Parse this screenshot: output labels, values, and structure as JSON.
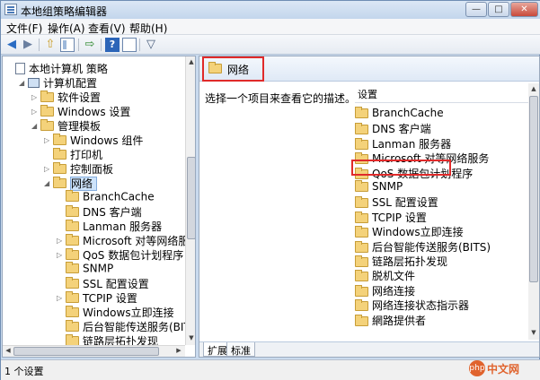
{
  "window": {
    "title": "本地组策略编辑器",
    "controls": {
      "minimize": "—",
      "maximize": "□",
      "close": "✕"
    }
  },
  "menubar": {
    "items": [
      "文件(F)",
      "操作(A)",
      "查看(V)",
      "帮助(H)"
    ]
  },
  "toolbar": {
    "icons": [
      "back-arrow-icon",
      "forward-arrow-icon",
      "up-folder-icon",
      "show-hide-tree-icon",
      "export-list-icon",
      "help-icon",
      "properties-icon",
      "filter-icon"
    ]
  },
  "tree": {
    "items": [
      {
        "label": "本地计算机 策略",
        "icon": "policy-icon",
        "expander": ""
      },
      {
        "label": "计算机配置",
        "icon": "computer-icon",
        "expander": "◢"
      },
      {
        "label": "软件设置",
        "icon": "folder-icon",
        "expander": "▷"
      },
      {
        "label": "Windows 设置",
        "icon": "folder-icon",
        "expander": "▷"
      },
      {
        "label": "管理模板",
        "icon": "folder-icon",
        "expander": "◢"
      },
      {
        "label": "Windows 组件",
        "icon": "folder-icon",
        "expander": "▷"
      },
      {
        "label": "打印机",
        "icon": "folder-icon",
        "expander": ""
      },
      {
        "label": "控制面板",
        "icon": "folder-icon",
        "expander": "▷"
      },
      {
        "label": "网络",
        "icon": "folder-icon",
        "expander": "◢"
      },
      {
        "label": "BranchCache",
        "icon": "folder-icon",
        "expander": ""
      },
      {
        "label": "DNS 客户端",
        "icon": "folder-icon",
        "expander": ""
      },
      {
        "label": "Lanman 服务器",
        "icon": "folder-icon",
        "expander": ""
      },
      {
        "label": "Microsoft 对等网络服务",
        "icon": "folder-icon",
        "expander": "▷"
      },
      {
        "label": "QoS 数据包计划程序",
        "icon": "folder-icon",
        "expander": "▷"
      },
      {
        "label": "SNMP",
        "icon": "folder-icon",
        "expander": ""
      },
      {
        "label": "SSL 配置设置",
        "icon": "folder-icon",
        "expander": ""
      },
      {
        "label": "TCPIP 设置",
        "icon": "folder-icon",
        "expander": "▷"
      },
      {
        "label": "Windows立即连接",
        "icon": "folder-icon",
        "expander": ""
      },
      {
        "label": "后台智能传送服务(BITS)",
        "icon": "folder-icon",
        "expander": ""
      },
      {
        "label": "链路层拓扑发现",
        "icon": "folder-icon",
        "expander": ""
      },
      {
        "label": "脱机文件",
        "icon": "folder-icon",
        "expander": ""
      }
    ]
  },
  "right": {
    "header_title": "网络",
    "description": "选择一个项目来查看它的描述。",
    "settings_header": "设置",
    "settings": [
      "BranchCache",
      "DNS 客户端",
      "Lanman 服务器",
      "Microsoft 对等网络服务",
      "QoS 数据包计划程序",
      "SNMP",
      "SSL 配置设置",
      "TCPIP 设置",
      "Windows立即连接",
      "后台智能传送服务(BITS)",
      "链路层拓扑发现",
      "脱机文件",
      "网络连接",
      "网络连接状态指示器",
      "網路提供者"
    ]
  },
  "tabs": [
    "扩展",
    "标准"
  ],
  "status": {
    "text": "1 个设置"
  },
  "watermark": {
    "logo": "php",
    "text": "中文网"
  },
  "colors": {
    "highlight_border": "#e02a2a",
    "selection_bg": "#cde3fb",
    "folder": "#f4d27a"
  }
}
